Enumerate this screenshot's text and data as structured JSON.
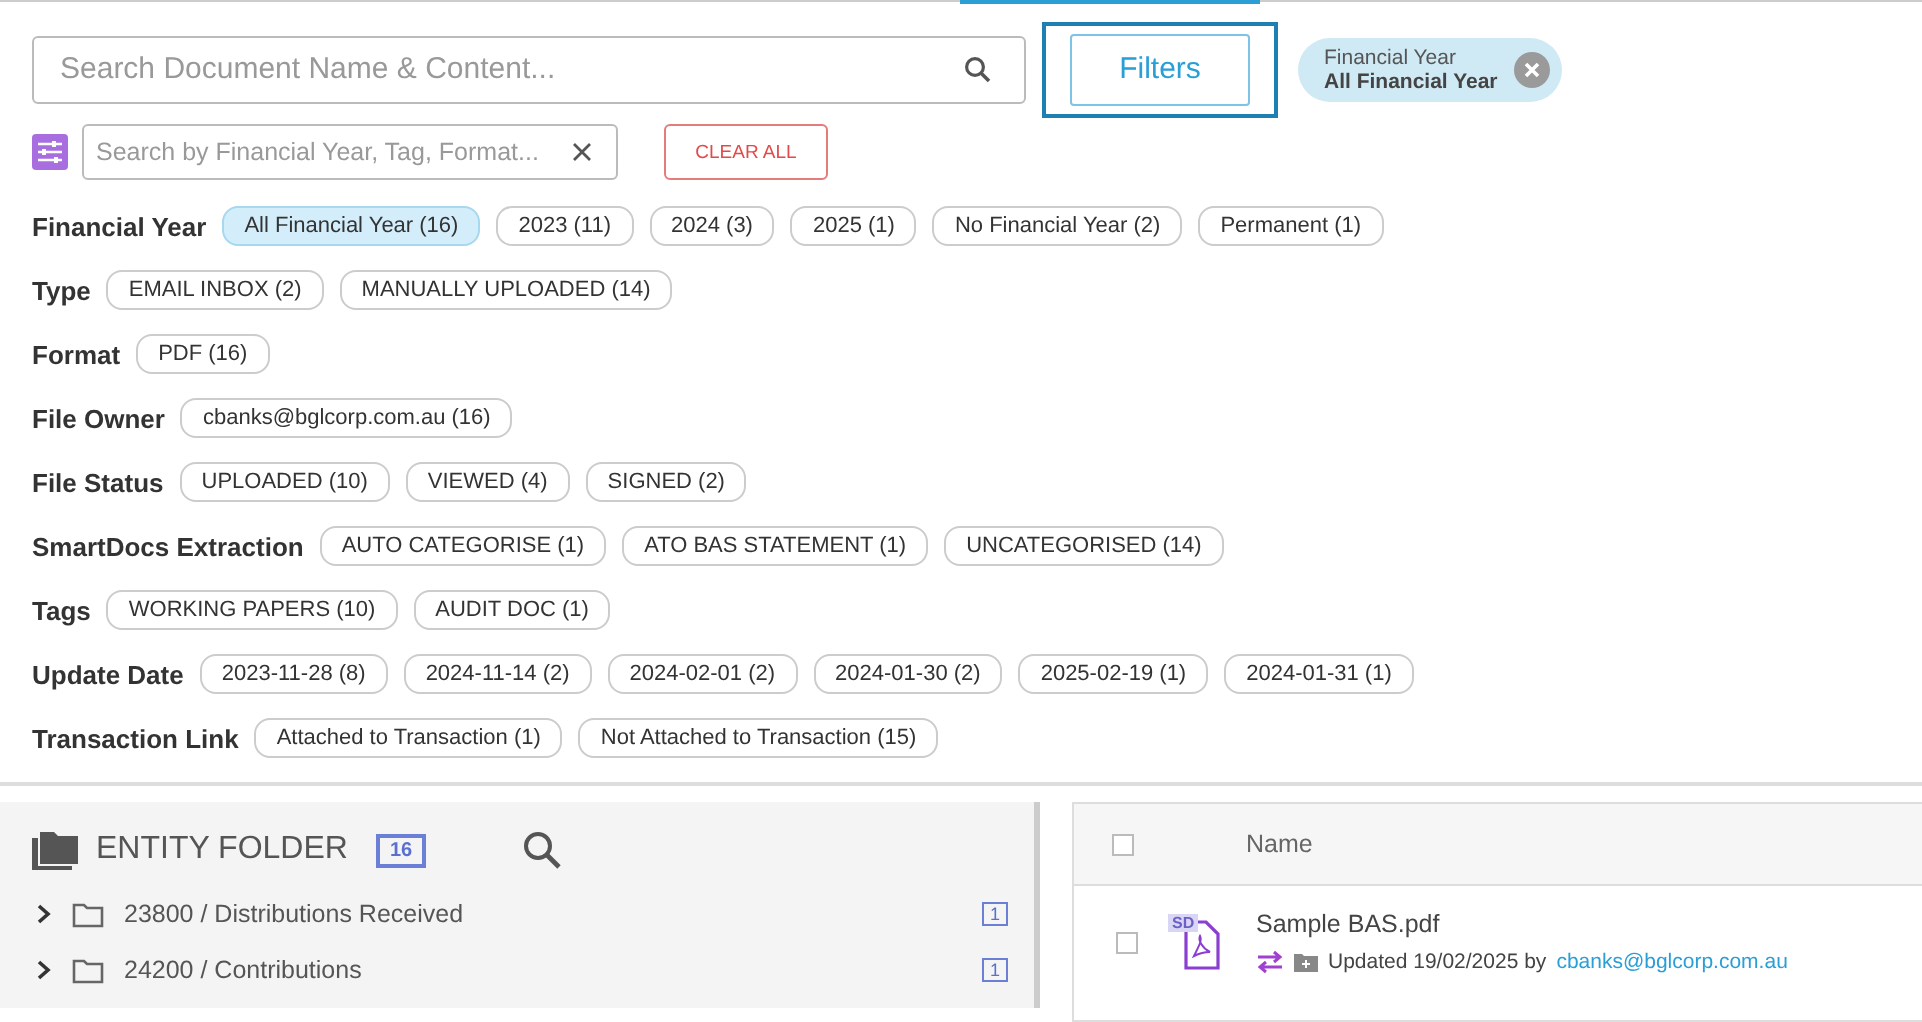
{
  "search": {
    "placeholder": "Search Document Name & Content..."
  },
  "filters_button": "Filters",
  "active_filter": {
    "label": "Financial Year",
    "value": "All Financial Year"
  },
  "filter_search": {
    "placeholder": "Search by Financial Year, Tag, Format..."
  },
  "clear_all": "CLEAR ALL",
  "filter_groups": [
    {
      "label": "Financial Year",
      "options": [
        {
          "label": "All Financial Year (16)",
          "selected": true
        },
        {
          "label": "2023 (11)",
          "selected": false
        },
        {
          "label": "2024 (3)",
          "selected": false
        },
        {
          "label": "2025 (1)",
          "selected": false
        },
        {
          "label": "No Financial Year (2)",
          "selected": false
        },
        {
          "label": "Permanent (1)",
          "selected": false
        }
      ]
    },
    {
      "label": "Type",
      "options": [
        {
          "label": "EMAIL INBOX (2)",
          "selected": false
        },
        {
          "label": "MANUALLY UPLOADED (14)",
          "selected": false
        }
      ]
    },
    {
      "label": "Format",
      "options": [
        {
          "label": "PDF (16)",
          "selected": false
        }
      ]
    },
    {
      "label": "File Owner",
      "options": [
        {
          "label": "cbanks@bglcorp.com.au (16)",
          "selected": false
        }
      ]
    },
    {
      "label": "File Status",
      "options": [
        {
          "label": "UPLOADED (10)",
          "selected": false
        },
        {
          "label": "VIEWED (4)",
          "selected": false
        },
        {
          "label": "SIGNED (2)",
          "selected": false
        }
      ]
    },
    {
      "label": "SmartDocs Extraction",
      "options": [
        {
          "label": "AUTO CATEGORISE (1)",
          "selected": false
        },
        {
          "label": "ATO BAS STATEMENT (1)",
          "selected": false
        },
        {
          "label": "UNCATEGORISED (14)",
          "selected": false
        }
      ]
    },
    {
      "label": "Tags",
      "options": [
        {
          "label": "WORKING PAPERS (10)",
          "selected": false
        },
        {
          "label": "AUDIT DOC (1)",
          "selected": false
        }
      ]
    },
    {
      "label": "Update Date",
      "options": [
        {
          "label": "2023-11-28 (8)",
          "selected": false
        },
        {
          "label": "2024-11-14 (2)",
          "selected": false
        },
        {
          "label": "2024-02-01 (2)",
          "selected": false
        },
        {
          "label": "2024-01-30 (2)",
          "selected": false
        },
        {
          "label": "2025-02-19 (1)",
          "selected": false
        },
        {
          "label": "2024-01-31 (1)",
          "selected": false
        }
      ]
    },
    {
      "label": "Transaction Link",
      "options": [
        {
          "label": "Attached to Transaction (1)",
          "selected": false
        },
        {
          "label": "Not Attached to Transaction (15)",
          "selected": false
        }
      ]
    }
  ],
  "entity_folder": {
    "title": "ENTITY FOLDER",
    "count": "16",
    "items": [
      {
        "label": "23800 / Distributions Received",
        "count": "1",
        "expanded": false
      },
      {
        "label": "24200 / Contributions",
        "count": "1",
        "expanded": false
      }
    ]
  },
  "files": {
    "columns": [
      "Name"
    ],
    "all_checked": false,
    "rows": [
      {
        "name": "Sample BAS.pdf",
        "badge": "SD",
        "checked": false,
        "updated": "Updated 19/02/2025 by",
        "owner": "cbanks@bglcorp.com.au"
      }
    ]
  }
}
